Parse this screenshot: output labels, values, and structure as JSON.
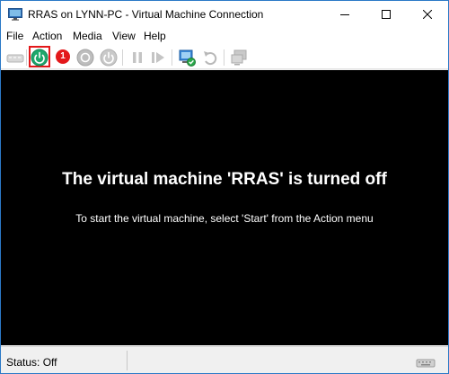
{
  "window": {
    "title": "RRAS on LYNN-PC - Virtual Machine Connection"
  },
  "menu": {
    "items": [
      "File",
      "Action",
      "Media",
      "View",
      "Help"
    ]
  },
  "toolbar": {
    "icons": [
      "ctrl-alt-del-icon",
      "start-icon",
      "turn-off-icon",
      "shut-down-icon",
      "save-icon",
      "pause-icon",
      "resume-icon",
      "checkpoint-icon",
      "revert-icon",
      "enhanced-session-icon"
    ],
    "badge": "1",
    "highlight_color": "#e3181a"
  },
  "console": {
    "heading": "The virtual machine 'RRAS' is turned off",
    "hint": "To start the virtual machine, select 'Start' from the Action menu",
    "background": "#000000"
  },
  "status": {
    "text": "Status: Off"
  }
}
